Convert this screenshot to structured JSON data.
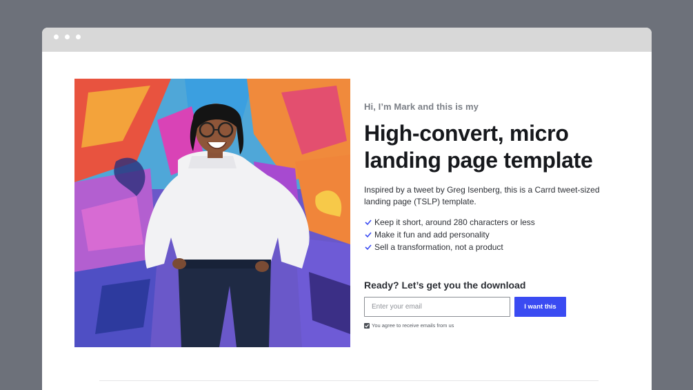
{
  "page": {
    "eyebrow": "Hi, I’m Mark and this is my",
    "headline_line1": "High-convert, micro",
    "headline_line2": "landing page template",
    "intro": "Inspired by a tweet by Greg Isenberg, this is a Carrd tweet-sized landing page (TSLP) template.",
    "bullets": [
      "Keep it short, around 280 characters or less",
      "Make it fun and add personality",
      "Sell a transformation, not a product"
    ],
    "cta_title": "Ready? Let’s get you the download",
    "email_placeholder": "Enter your email",
    "button_label": "I want this",
    "consent_text": "You agree to receive emails from us"
  },
  "colors": {
    "accent": "#3a4bf2",
    "background": "#6d717a",
    "titlebar": "#d8d8d8"
  },
  "icons": {
    "bullet": "check-icon",
    "consent": "checkbox-checked-icon"
  }
}
